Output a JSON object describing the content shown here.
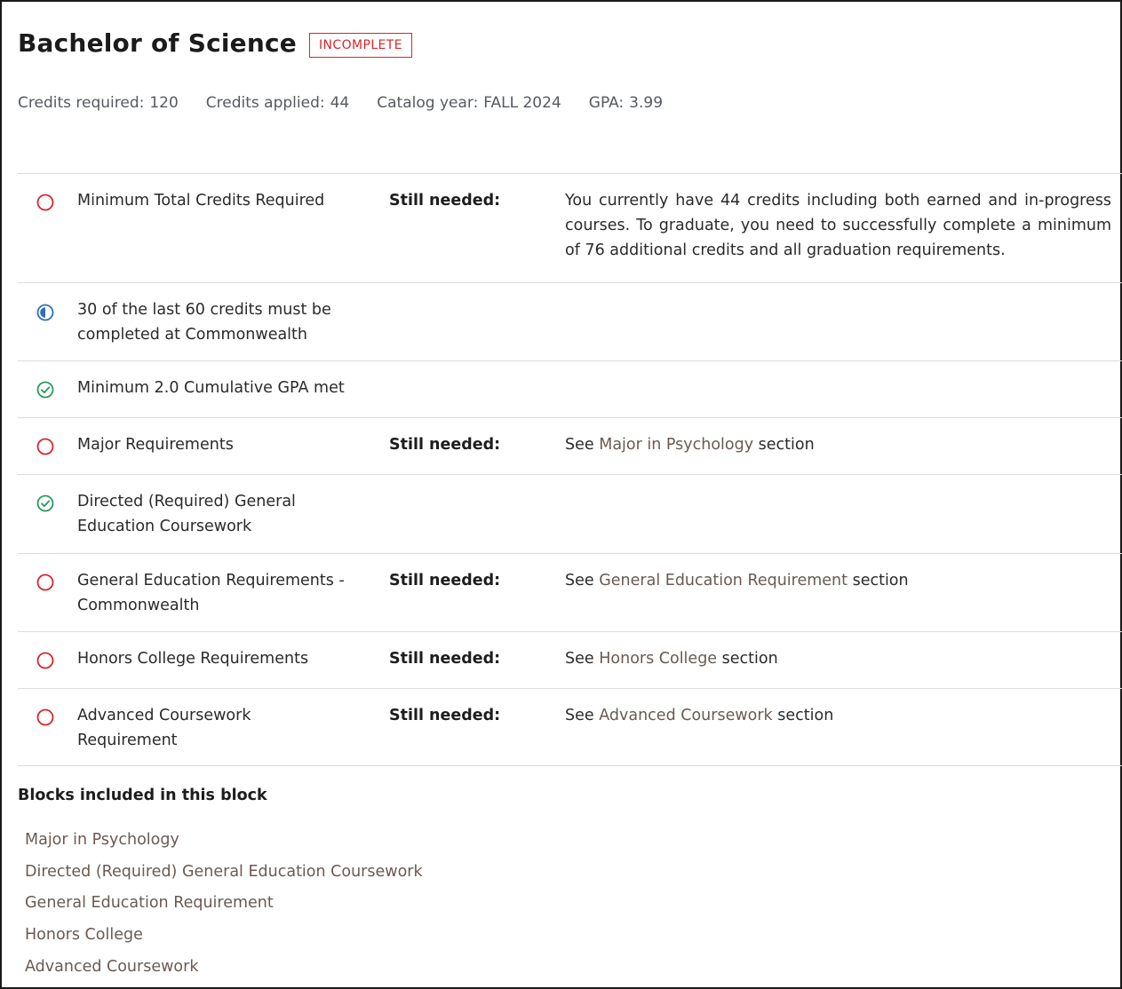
{
  "header": {
    "title": "Bachelor of Science",
    "status_badge": "INCOMPLETE"
  },
  "stats": [
    {
      "label": "Credits required:",
      "value": "120"
    },
    {
      "label": "Credits applied:",
      "value": "44"
    },
    {
      "label": "Catalog year:",
      "value": "FALL 2024"
    },
    {
      "label": "GPA:",
      "value": "3.99"
    }
  ],
  "colors": {
    "incomplete": "#d6262b",
    "in_progress": "#2f6fbf",
    "complete": "#2a9a5a",
    "link": "#6a5a52"
  },
  "requirements": [
    {
      "status_icon": "incomplete-circle-icon",
      "label": "Minimum Total Credits Required",
      "still_needed": "Still needed:",
      "detail": "You currently have 44 credits including both earned and in-progress courses. To graduate, you need to successfully complete a minimum of 76 additional credits and all graduation requirements."
    },
    {
      "status_icon": "in-progress-circle-icon",
      "label": "30 of the last 60 credits must be completed at Commonwealth"
    },
    {
      "status_icon": "complete-check-icon",
      "label": "Minimum 2.0 Cumulative GPA met"
    },
    {
      "status_icon": "incomplete-circle-icon",
      "label": "Major Requirements",
      "still_needed": "Still needed:",
      "see_prefix": "See",
      "link": "Major in Psychology",
      "see_suffix": "section"
    },
    {
      "status_icon": "complete-check-icon",
      "label": "Directed (Required) General Education Coursework"
    },
    {
      "status_icon": "incomplete-circle-icon",
      "label": "General Education Requirements - Commonwealth",
      "still_needed": "Still needed:",
      "see_prefix": "See",
      "link": "General Education Requirement",
      "see_suffix": "section"
    },
    {
      "status_icon": "incomplete-circle-icon",
      "label": "Honors College Requirements",
      "still_needed": "Still needed:",
      "see_prefix": "See",
      "link": "Honors College",
      "see_suffix": "section"
    },
    {
      "status_icon": "incomplete-circle-icon",
      "label": "Advanced Coursework Requirement",
      "still_needed": "Still needed:",
      "see_prefix": "See",
      "link": "Advanced Coursework",
      "see_suffix": "section"
    }
  ],
  "blocks": {
    "title": "Blocks included in this block",
    "items": [
      "Major in Psychology",
      "Directed (Required) General Education Coursework",
      "General Education Requirement",
      "Honors College",
      "Advanced Coursework"
    ]
  }
}
